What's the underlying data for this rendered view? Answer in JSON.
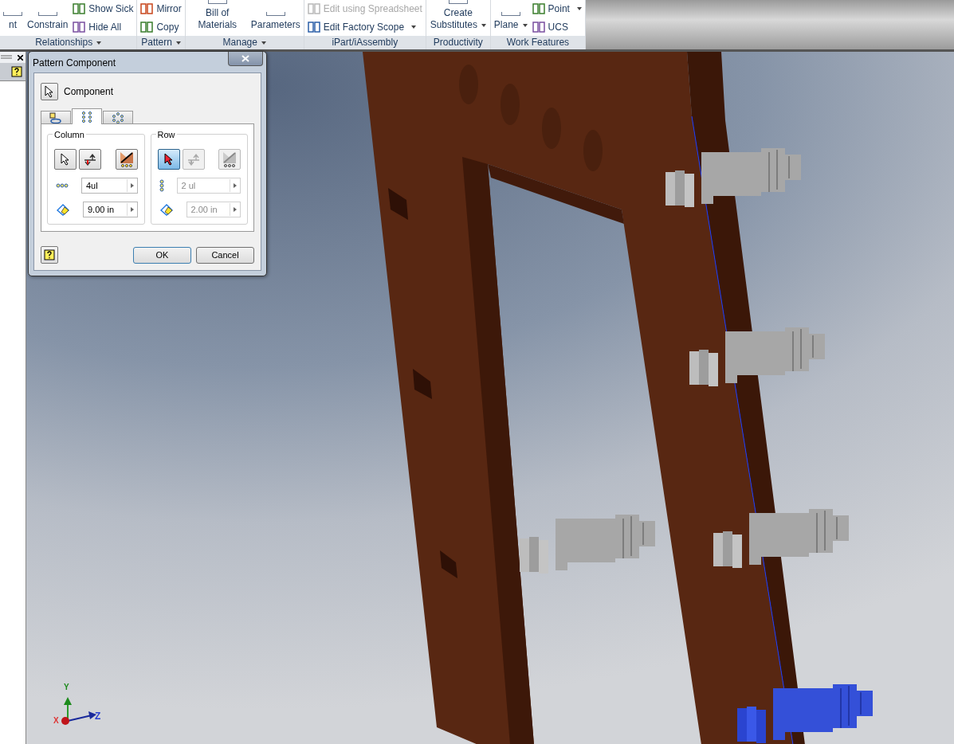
{
  "ribbon": {
    "panels": [
      {
        "title": "Relationships",
        "menu": true,
        "columns": [
          [
            {
              "label": "nt",
              "kind": "large",
              "disabled": false,
              "dropdown": false
            }
          ],
          [
            {
              "label": "Constrain",
              "kind": "large",
              "disabled": false,
              "dropdown": false
            }
          ],
          [
            {
              "label": "Show Sick",
              "kind": "small",
              "disabled": false,
              "dropdown": false
            },
            {
              "label": "Hide All",
              "kind": "small",
              "disabled": false,
              "dropdown": false
            }
          ]
        ]
      },
      {
        "title": "Pattern",
        "menu": true,
        "columns": [
          [
            {
              "label": "Mirror",
              "kind": "small",
              "disabled": false,
              "dropdown": false
            },
            {
              "label": "Copy",
              "kind": "small",
              "disabled": false,
              "dropdown": false
            }
          ]
        ]
      },
      {
        "title": "Manage",
        "menu": true,
        "columns": [
          [
            {
              "label": "Bill of Materials",
              "kind": "large",
              "disabled": false,
              "dropdown": false
            }
          ],
          [
            {
              "label": "Parameters",
              "kind": "large",
              "disabled": false,
              "dropdown": false
            }
          ]
        ]
      },
      {
        "title": "iPart/iAssembly",
        "menu": false,
        "columns": [
          [
            {
              "label": "Edit using Spreadsheet",
              "kind": "small",
              "disabled": true,
              "dropdown": false
            },
            {
              "label": "Edit Factory Scope",
              "kind": "small",
              "disabled": false,
              "dropdown": true
            }
          ]
        ]
      },
      {
        "title": "Productivity",
        "menu": false,
        "columns": [
          [
            {
              "label": "Create Substitutes",
              "kind": "large",
              "disabled": false,
              "dropdown": true
            }
          ]
        ]
      },
      {
        "title": "Work Features",
        "menu": false,
        "columns": [
          [
            {
              "label": "Plane",
              "kind": "large",
              "disabled": false,
              "dropdown": true
            }
          ],
          [
            {
              "label": "Point",
              "kind": "small",
              "disabled": false,
              "dropdown": true
            },
            {
              "label": "UCS",
              "kind": "small",
              "disabled": false,
              "dropdown": false
            }
          ]
        ]
      }
    ]
  },
  "dialog": {
    "title": "Pattern Component",
    "component_label": "Component",
    "tabs": [
      {
        "selected": false
      },
      {
        "selected": true
      },
      {
        "selected": false
      }
    ],
    "groups": [
      {
        "title": "Column",
        "disabled": false,
        "select_pressed": false,
        "count": "4ul",
        "spacing": "9.00 in"
      },
      {
        "title": "Row",
        "disabled": true,
        "select_pressed": true,
        "count": "2 ul",
        "spacing": "2.00 in"
      }
    ],
    "buttons": [
      "OK",
      "Cancel"
    ]
  },
  "triad": {
    "y": "Y",
    "x": "X",
    "z": "Z"
  }
}
